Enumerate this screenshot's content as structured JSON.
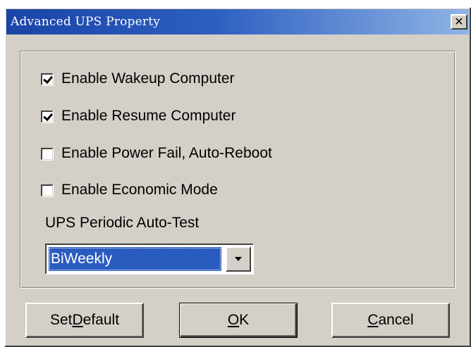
{
  "window": {
    "title": "Advanced UPS Property",
    "close_glyph": "✕"
  },
  "options": [
    {
      "label": "Enable Wakeup Computer",
      "checked": true
    },
    {
      "label": "Enable Resume Computer",
      "checked": true
    },
    {
      "label": "Enable Power Fail, Auto-Reboot",
      "checked": false
    },
    {
      "label": "Enable Economic Mode",
      "checked": false
    }
  ],
  "autotest": {
    "label": "UPS Periodic Auto-Test",
    "selected": "BiWeekly"
  },
  "buttons": {
    "set_default": {
      "before": "Set ",
      "mnemonic": "D",
      "after": "efault"
    },
    "ok": {
      "before": "",
      "mnemonic": "O",
      "after": "K"
    },
    "cancel": {
      "before": "",
      "mnemonic": "C",
      "after": "ancel"
    }
  },
  "colors": {
    "titlebar_start": "#1a44a8",
    "titlebar_end": "#8fb4e6",
    "face": "#d4d0c8",
    "selection": "#2a5bbf"
  },
  "icons": {
    "close": "close-icon",
    "dropdown": "chevron-down-icon",
    "check": "checkmark-icon"
  }
}
